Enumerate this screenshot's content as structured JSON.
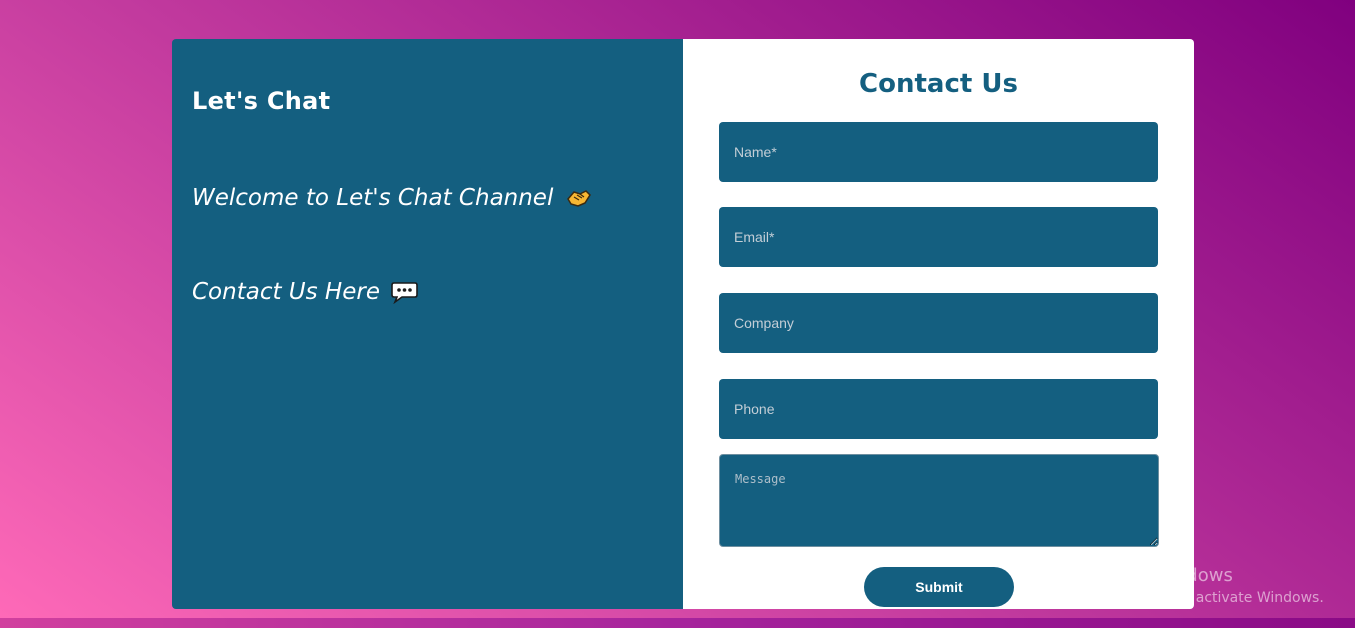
{
  "left": {
    "brand": "Let's Chat",
    "welcome": "Welcome to Let's Chat Channel",
    "contact_here": "Contact Us Here",
    "icons": [
      "handshake-icon",
      "speech-bubble-icon"
    ]
  },
  "form": {
    "title": "Contact Us",
    "name_placeholder": "Name*",
    "email_placeholder": "Email*",
    "company_placeholder": "Company",
    "phone_placeholder": "Phone",
    "message_placeholder": "Message",
    "submit_label": "Submit"
  },
  "watermark": {
    "line1": "Activate Windows",
    "line2": "Go to Settings to activate Windows."
  },
  "colors": {
    "panel": "#145f80",
    "accent": "#145f80",
    "background_start": "#ff6ab8",
    "background_end": "#80007f"
  }
}
